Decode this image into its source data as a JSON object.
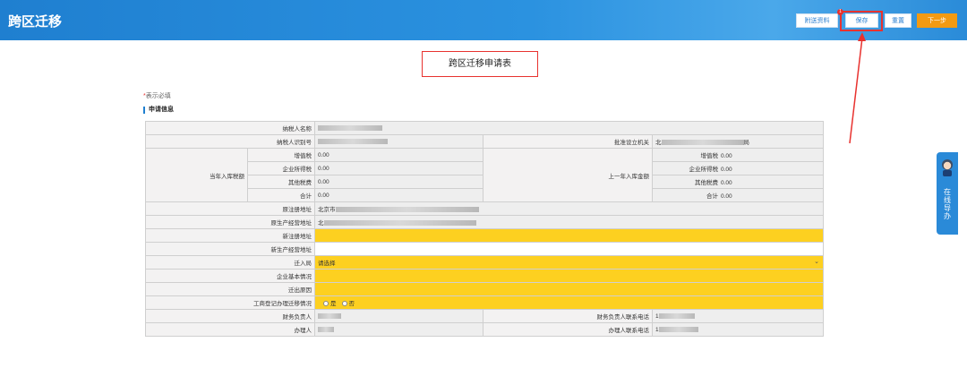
{
  "app": {
    "title": "跨区迁移"
  },
  "toolbar": {
    "send_label": "附送资料",
    "save_label": "保存",
    "reset_label": "重置",
    "next_label": "下一步",
    "badge": "1"
  },
  "form": {
    "title": "跨区迁移申请表",
    "required_star": "*",
    "required_note": "表示必填",
    "section_title": "申请信息",
    "labels": {
      "taxpayer_name": "纳税人名称",
      "taxpayer_id": "纳税人识别号",
      "approval_org": "批准设立机关",
      "current_year_tax": "当年入库税额",
      "last_year_tax": "上一年入库金额",
      "vat": "增值税",
      "cit": "企业所得税",
      "other_tax": "其他税费",
      "total": "合计",
      "orig_reg_addr": "原注册地址",
      "orig_biz_addr": "原生产经营地址",
      "new_reg_addr": "新注册地址",
      "new_biz_addr": "新生产经营地址",
      "move_to_bureau": "迁入局",
      "company_basic": "企业基本情况",
      "move_reason": "迁出原因",
      "biz_reg_status": "工商登记办理迁移情况",
      "finance_person": "财务负责人",
      "finance_phone": "财务负责人联系电话",
      "handler": "办理人",
      "handler_phone": "办理人联系电话"
    },
    "values": {
      "current_vat": "0.00",
      "current_cit": "0.00",
      "current_other": "0.00",
      "current_total": "0.00",
      "last_vat": "0.00",
      "last_cit": "0.00",
      "last_other": "0.00",
      "last_total": "0.00",
      "orig_reg_prefix": "北京市",
      "orig_biz_prefix": "北",
      "approval_prefix": "北",
      "approval_suffix": "局",
      "finance_phone_prefix": "1",
      "handler_phone_prefix": "1"
    },
    "bureau_placeholder": "请选择",
    "radio_yes": "是",
    "radio_no": "否"
  },
  "side_widget": {
    "label": "在线导办"
  },
  "colors": {
    "header": "#1f7fd0",
    "accent_yellow": "#fdd020",
    "highlight_red": "#e8322f",
    "next_orange": "#f39a12"
  }
}
